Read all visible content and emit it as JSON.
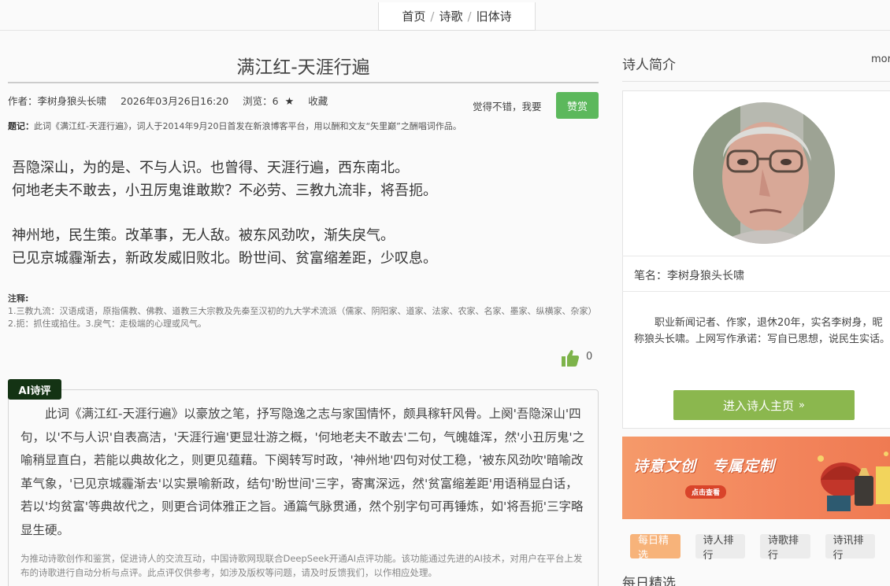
{
  "breadcrumb": {
    "home": "首页",
    "sep1": "/",
    "poetry": "诗歌",
    "sep2": "/",
    "category": "旧体诗"
  },
  "poem": {
    "title": "满江红-天涯行遍",
    "author_label": "作者：李树身狼头长啸",
    "datetime": "2026年03月26日16:20",
    "views_label": "浏览：6",
    "collect_label": "收藏",
    "like_prompt": "觉得不错，我要",
    "reward_label": "赞赏",
    "inscription_label": "题记：",
    "inscription_text": "此词《满江红-天涯行遍》，词人于2014年9月20日首发在新浪博客平台，用以酬和文友“矢里巅”之酬唱词作品。",
    "lines": [
      "吾隐深山，为的是、不与人识。也曾得、天涯行遍，西东南北。",
      "何地老夫不敢去，小丑厉鬼谁敢欺？不必劳、三教九流非，将吾扼。",
      "神州地，民生策。改革事，无人敌。被东风劲吹，渐失戾气。",
      "已见京城霾渐去，新政发威旧败北。盼世间、贫富缩差距，少叹息。"
    ],
    "notes_label": "注释:",
    "notes_text": "1.三教九流：汉语成语，原指儒教、佛教、道教三大宗教及先秦至汉初的九大学术流派（儒家、阴阳家、道家、法家、农家、名家、墨家、纵横家、杂家）2.扼：抓住或掐住。3.戾气：走极端的心理或风气。",
    "like_count": "0"
  },
  "ai": {
    "tag": "AI诗评",
    "review": "此词《满江红-天涯行遍》以豪放之笔，抒写隐逸之志与家国情怀，颇具稼轩风骨。上阕'吾隐深山'四句，以'不与人识'自表高洁，'天涯行遍'更显壮游之概，'何地老夫不敢去'二句，气魄雄浑，然'小丑厉鬼'之喻稍显直白，若能以典故化之，则更见蕴藉。下阕转写时政，'神州地'四句对仗工稳，'被东风劲吹'暗喻改革气象，'已见京城霾渐去'以实景喻新政，结句'盼世间'三字，寄寓深远，然'贫富缩差距'用语稍显白话，若以'均贫富'等典故代之，则更合词体雅正之旨。通篇气脉贯通，然个别字句可再锤炼，如'将吾扼'三字略显生硬。",
    "disclaimer": "为推动诗歌创作和鉴赏，促进诗人的交流互动，中国诗歌网现联合DeepSeek开通AI点评功能。该功能通过先进的AI技术，对用户在平台上发布的诗歌进行自动分析与点评。此点评仅供参考，如涉及版权等问题，请及时反馈我们，以作相应处理。"
  },
  "sidebar": {
    "intro_heading": "诗人简介",
    "more": "more",
    "penname": "笔名：李树身狼头长啸",
    "bio": "职业新闻记者、作家，退休20年，实名李树身，昵称狼头长啸。上网写作承诺：写自已思想，说民生实话。",
    "enter_button": "进入诗人主页",
    "enter_arrow": "»",
    "banner_title": "诗意文创　专属定制",
    "banner_tag": "点击查看",
    "tabs": [
      "每日精选",
      "诗人排行",
      "诗歌排行",
      "诗讯排行"
    ],
    "daily_heading": "每日精选"
  },
  "colors": {
    "reward": "#5cb85c",
    "enter": "#8bb74e",
    "ai_tag": "#143314",
    "tab_active": "#f7b37a"
  }
}
